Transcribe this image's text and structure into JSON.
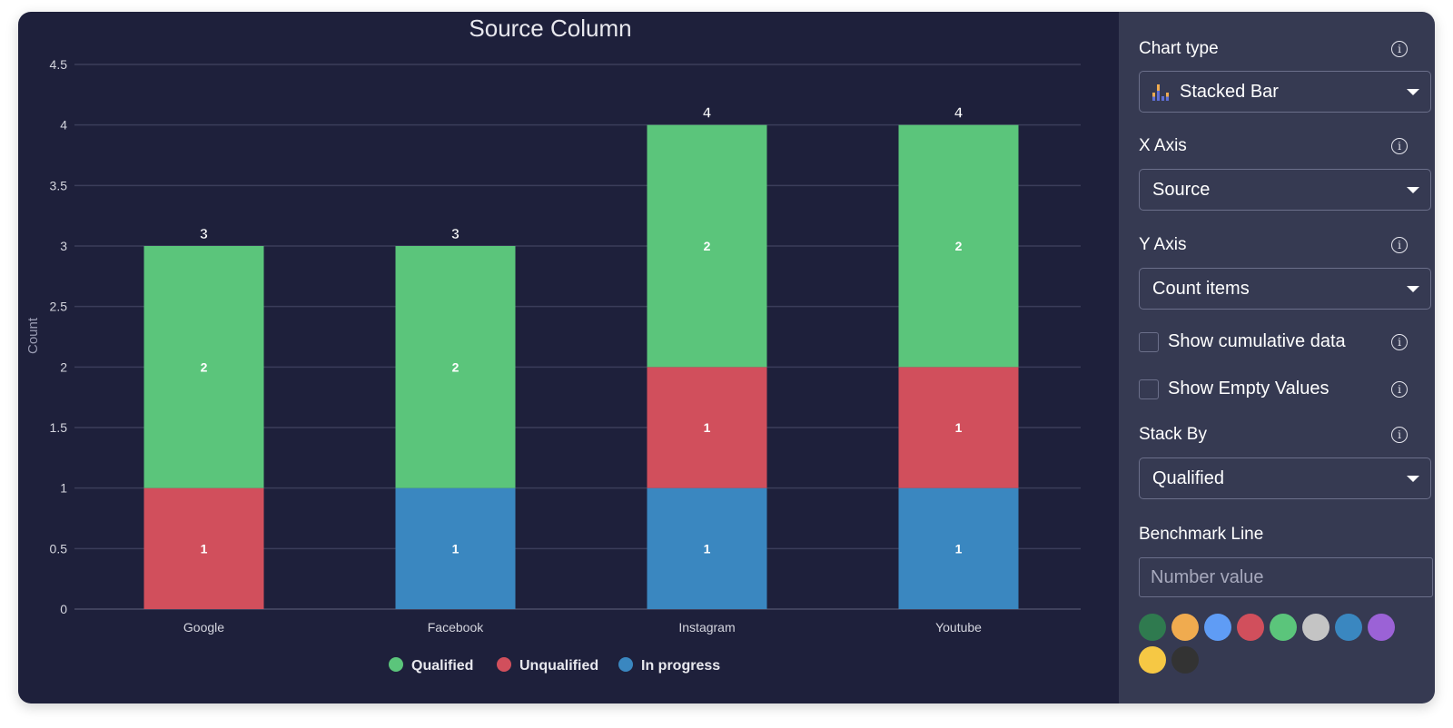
{
  "chart_data": {
    "type": "bar",
    "stacked": true,
    "title": "Source Column",
    "xlabel": "",
    "ylabel": "Count",
    "ylim": [
      0,
      4.5
    ],
    "yticks": [
      "0",
      "0.5",
      "1",
      "1.5",
      "2",
      "2.5",
      "3",
      "3.5",
      "4",
      "4.5"
    ],
    "grid": true,
    "categories": [
      "Google",
      "Facebook",
      "Instagram",
      "Youtube"
    ],
    "series": [
      {
        "name": "In progress",
        "color": "#3a87c0",
        "values": [
          0,
          1,
          1,
          1
        ]
      },
      {
        "name": "Unqualified",
        "color": "#d14f5c",
        "values": [
          1,
          0,
          1,
          1
        ]
      },
      {
        "name": "Qualified",
        "color": "#5bc57b",
        "values": [
          2,
          2,
          2,
          2
        ]
      }
    ],
    "totals": [
      3,
      3,
      4,
      4
    ],
    "legend": {
      "placement": "bottom",
      "entries": [
        {
          "label": "Qualified",
          "color": "#5bc57b"
        },
        {
          "label": "Unqualified",
          "color": "#d14f5c"
        },
        {
          "label": "In progress",
          "color": "#3a87c0"
        }
      ]
    }
  },
  "settings": {
    "chart_type": {
      "label": "Chart type",
      "value": "Stacked Bar",
      "icon": "stacked-bar-chart-icon"
    },
    "x_axis": {
      "label": "X Axis",
      "value": "Source"
    },
    "y_axis": {
      "label": "Y Axis",
      "value": "Count items"
    },
    "show_cumulative": {
      "label": "Show cumulative data",
      "checked": false
    },
    "show_empty": {
      "label": "Show Empty Values",
      "checked": false
    },
    "stack_by": {
      "label": "Stack By",
      "value": "Qualified"
    },
    "benchmark": {
      "label": "Benchmark Line",
      "placeholder": "Number value",
      "value": ""
    },
    "info_icon": "i",
    "colors": [
      "#2f7a4f",
      "#f0ab4f",
      "#5f9cf5",
      "#d14f5c",
      "#5bc57b",
      "#c4c4c4",
      "#3a87c0",
      "#9b62d6",
      "#f6c844",
      "#333333"
    ]
  }
}
